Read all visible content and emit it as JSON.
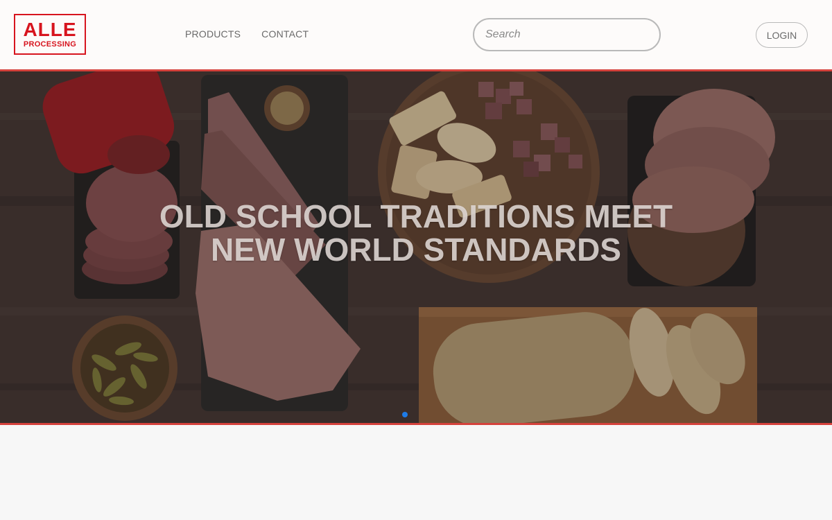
{
  "header": {
    "logo": {
      "main": "ALLE",
      "sub": "PROCESSING"
    },
    "nav": [
      {
        "label": "PRODUCTS"
      },
      {
        "label": "CONTACT"
      }
    ],
    "search": {
      "placeholder": "Search",
      "value": ""
    },
    "login_label": "LOGIN"
  },
  "hero": {
    "headline": "OLD SCHOOL TRADITIONS MEET NEW WORLD STANDARDS",
    "active_slide": 1,
    "colors": {
      "border": "#d5423c",
      "dot": "#1e7be6"
    }
  },
  "colors": {
    "brand": "#d7141e",
    "background": "#f7f7f7"
  }
}
